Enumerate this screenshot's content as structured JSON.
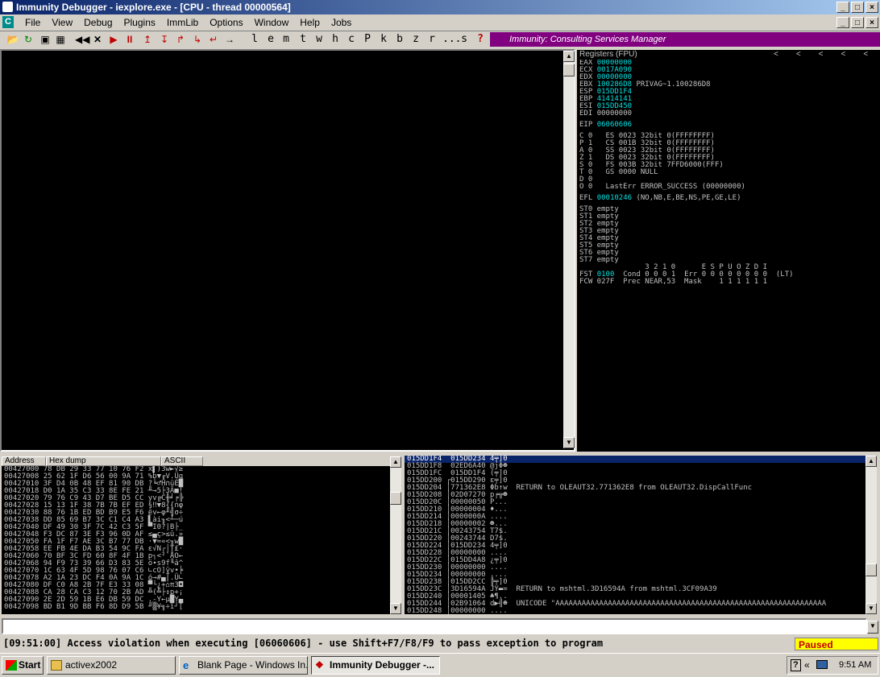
{
  "window": {
    "title": "Immunity Debugger - iexplore.exe - [CPU - thread 00000564]"
  },
  "menu": [
    "File",
    "View",
    "Debug",
    "Plugins",
    "ImmLib",
    "Options",
    "Window",
    "Help",
    "Jobs"
  ],
  "toolbar_letters": [
    "l",
    "e",
    "m",
    "t",
    "w",
    "h",
    "c",
    "P",
    "k",
    "b",
    "z",
    "r",
    "...",
    "s",
    "?"
  ],
  "csm_label": "Immunity: Consulting Services Manager",
  "registers": {
    "header": "Registers (FPU)",
    "gp": [
      {
        "name": "EAX",
        "value": "00000000",
        "extra": ""
      },
      {
        "name": "ECX",
        "value": "0017A090",
        "extra": ""
      },
      {
        "name": "EDX",
        "value": "00000000",
        "extra": ""
      },
      {
        "name": "EBX",
        "value": "100286D8",
        "extra": "PRIVAG~1.100286D8"
      },
      {
        "name": "ESP",
        "value": "015DD1F4",
        "extra": ""
      },
      {
        "name": "EBP",
        "value": "41414141",
        "extra": ""
      },
      {
        "name": "ESI",
        "value": "015DD450",
        "extra": ""
      },
      {
        "name": "EDI",
        "value": "00000000",
        "extra": ""
      }
    ],
    "eip": {
      "name": "EIP",
      "value": "06060606"
    },
    "flags": [
      "C 0   ES 0023 32bit 0(FFFFFFFF)",
      "P 1   CS 001B 32bit 0(FFFFFFFF)",
      "A 0   SS 0023 32bit 0(FFFFFFFF)",
      "Z 1   DS 0023 32bit 0(FFFFFFFF)",
      "S 0   FS 003B 32bit 7FFD6000(FFF)",
      "T 0   GS 0000 NULL",
      "D 0",
      "O 0   LastErr ERROR_SUCCESS (00000000)"
    ],
    "efl": {
      "name": "EFL",
      "value": "00010246",
      "extra": "(NO,NB,E,BE,NS,PE,GE,LE)"
    },
    "st": [
      "ST0 empty",
      "ST1 empty",
      "ST2 empty",
      "ST3 empty",
      "ST4 empty",
      "ST5 empty",
      "ST6 empty",
      "ST7 empty"
    ],
    "fpu_hdr": "               3 2 1 0      E S P U O Z D I",
    "fst": {
      "name": "FST",
      "value": "0100",
      "rest": "  Cond 0 0 0 1  Err 0 0 0 0 0 0 0 0  (LT)"
    },
    "fcw": "FCW 027F  Prec NEAR,53  Mask    1 1 1 1 1 1"
  },
  "dump": {
    "headers": [
      "Address",
      "Hex dump",
      "ASCII"
    ],
    "rows": [
      "00427000 78 DB 29 33 77 10 76 F2 x▌)3w►√≥",
      "00427008 25 62 1F D6 56 00 9A 71 %b▼╓V.Üq",
      "00427010 3F D4 0B 48 EF 81 90 DB ?╘♂H∩üÉ█",
      "00427018 D0 1A 35 C3 33 8E FE 21 ╨→5├3Ä■!",
      "00427020 79 76 C9 43 D7 BE D5 CC yv╔C╫╛╒╠",
      "00427028 15 13 1F 38 7B 7B EF ED §‼▼8{{∩φ",
      "00427030 88 76 1B ED BD B9 E5 F6 êv←φ╜╣σ÷",
      "00427038 DD 85 69 B7 3C C1 C4 A3 ▌ài╖<┴─ú",
      "00427040 DF 49 30 3F 7C 42 C3 5F ▀I0?|B├_",
      "00427048 F3 DC 87 3E F3 96 0D AF ≤▄ç>≤û.»",
      "00427050 FA 1F F7 AE 3C B7 77 DB ·▼≈«<╖w█",
      "00427058 EE FB 4E DA B3 54 9C FA ε√N┌│T£·",
      "00427060 70 BF 3C FD 60 8F 4F 1B p┐<²`ÅO←",
      "00427068 94 F9 73 39 66 D3 83 5E ö∙s9f╙â^",
      "00427070 1C 63 4F 5D 98 76 07 C6 ∟cO]ÿv•╞",
      "00427078 A2 1A 23 DC F4 0A 9A 1C ó→#▄⌠.Ü∟",
      "00427080 DF C0 A8 2B 7F E3 33 08 ▀└¿+⌂π3◘",
      "00427088 CA 28 CA C3 12 70 2B AD ╩(╩├↕p+¡",
      "00427090 2E 2D 59 1B E6 DB 59 DC .-Y←µ█Y▄",
      "00427098 BD B1 9D BB F6 8D D9 5B ╜▒¥╗÷ì┘["
    ]
  },
  "stack": {
    "rows": [
      "015DD1F4  015DD234 4╤]0",
      "015DD1F8  02ED6A40 @jΦ☻",
      "015DD1FC  015DD1F4 (╤]0",
      "015DD200 ┌015DD290 ε╤]0",
      "015DD204 │771362E8 Φb↑w  RETURN to OLEAUT32.771362E8 from OLEAUT32.DispCallFunc",
      "015DD208 │02D07270 p╒╦☻",
      "015DD20C │00000050 P...",
      "015DD210 │00000004 ♦...",
      "015DD214 │0000000A ....",
      "015DD218 │00000002 ☻...",
      "015DD21C │00243754 T7$.",
      "015DD220 │00243744 D7$.",
      "015DD224 │015DD234 4╤]0",
      "015DD228 │00000000 ....",
      "015DD22C │015DD4A8 ¿╤]0",
      "015DD230 │00000000 ....",
      "015DD234 │00000000 ....",
      "015DD238 │015DD2CC ╠╤]0",
      "015DD23C │3D16594A JY▬=  RETURN to mshtml.3D16594A from mshtml.3CF09A39",
      "015DD240 │00001405 ♣¶..",
      "015DD244 │02B91064 d▶╣☻  UNICODE \"AAAAAAAAAAAAAAAAAAAAAAAAAAAAAAAAAAAAAAAAAAAAAAAAAAAAAAAAAAAAAA",
      "015DD248 │00000000 ...."
    ]
  },
  "status": {
    "message": "[09:51:00] Access violation when executing [06060606] - use Shift+F7/F8/F9 to pass exception to program",
    "state": "Paused"
  },
  "taskbar": {
    "start": "Start",
    "items": [
      "activex2002",
      "Blank Page - Windows In...",
      "Immunity Debugger -..."
    ],
    "clock": "9:51 AM"
  },
  "colors": {
    "title": "#0a246a",
    "accent": "#800080",
    "paused": "#ffff00",
    "highlight": "#00e0e0"
  }
}
